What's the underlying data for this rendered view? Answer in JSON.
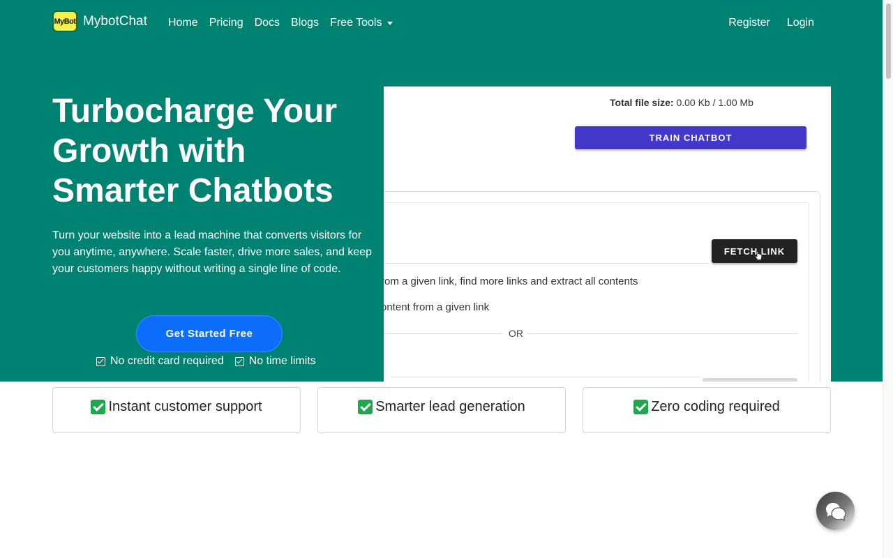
{
  "brand": {
    "logo_text": "MyBot",
    "name": "MybotChat"
  },
  "nav": {
    "links": [
      "Home",
      "Pricing",
      "Docs",
      "Blogs",
      "Free Tools"
    ],
    "right": [
      "Register",
      "Login"
    ]
  },
  "hero": {
    "headline": "Turbocharge Your Growth with Smarter Chatbots",
    "subtext": "Turn your website into a lead machine that converts visitors for you anytime, anywhere. Scale faster, drive more sales, and keep your customers happy without writing a single line of code.",
    "cta": "Get Started Free",
    "perks": [
      "No credit card required",
      "No time limits"
    ]
  },
  "panel": {
    "filesize_label": "Total file size:",
    "filesize_value": "0.00 Kb / 1.00 Mb",
    "train_button": "TRAIN CHATBOT",
    "fetch_button": "FETCH LINK",
    "option_crawl": "rom a given link, find more links and extract all contents",
    "option_single": "ontent from a given link",
    "or_text": "OR"
  },
  "features": [
    "Instant customer support",
    "Smarter lead generation",
    "Zero coding required"
  ],
  "colors": {
    "hero_bg": "#008272",
    "cta": "#0d6efd",
    "train_button": "#4338ca",
    "fetch_button": "#222222",
    "check": "#1ea84a"
  },
  "icons": [
    "chevron-down-icon",
    "checkbox-icon",
    "check-mark-icon",
    "chat-bubble-icon",
    "pointer-cursor-icon"
  ]
}
